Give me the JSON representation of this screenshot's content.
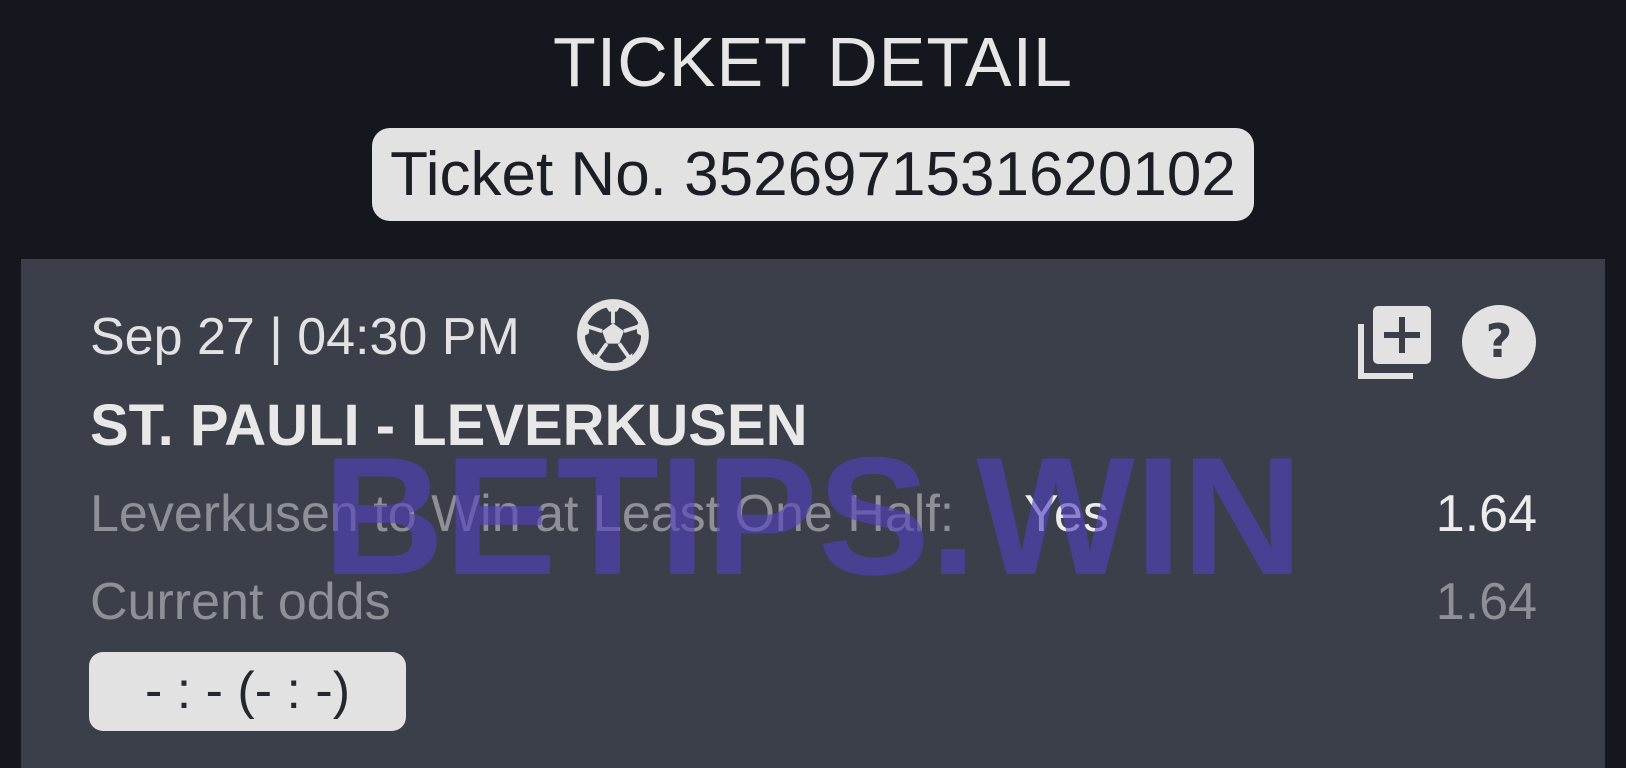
{
  "header": {
    "title": "TICKET DETAIL",
    "ticket_number": "Ticket No. 3526971531620102"
  },
  "event": {
    "datetime": "Sep 27 | 04:30 PM",
    "sport_icon": "soccer-ball-icon",
    "match": "ST. PAULI - LEVERKUSEN",
    "market": "Leverkusen to Win at Least One Half:",
    "pick": "Yes",
    "odds": "1.64",
    "current_odds_label": "Current odds",
    "current_odds": "1.64",
    "score": "- : - (- : -)"
  },
  "actions": {
    "add_icon": "add-to-collection-icon",
    "help_icon": "help-icon"
  },
  "watermark": {
    "text": "BETIPS.WIN"
  },
  "colors": {
    "background": "#14171d",
    "card": "#3b3f4a",
    "pill": "#e2e2e2",
    "watermark": "#5040be"
  }
}
